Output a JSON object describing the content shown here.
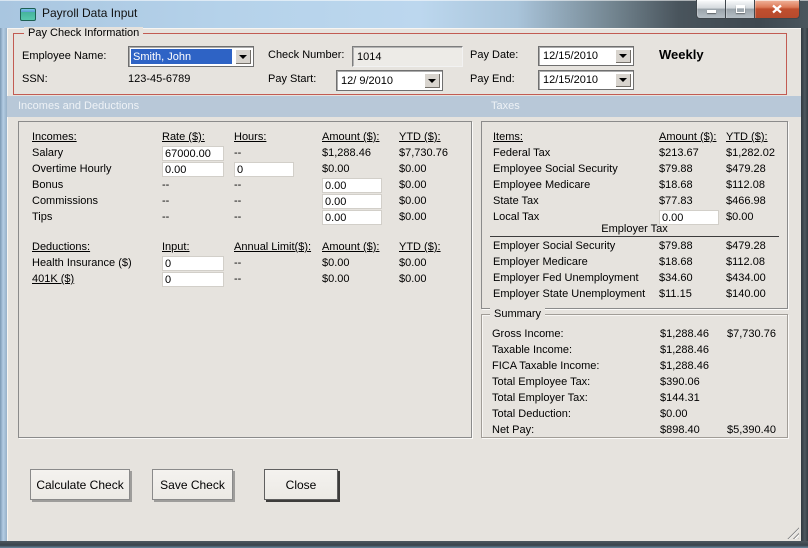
{
  "window": {
    "title": "Payroll Data Input"
  },
  "icons": {
    "app": "form-window-icon",
    "minimize": "minimize-icon",
    "maximize": "maximize-icon",
    "close": "close-icon",
    "dropdown": "chevron-down-icon",
    "resize": "resize-grip-icon"
  },
  "colors": {
    "section_header_bg": "#b8c8d8",
    "group_border_red": "#c25b52",
    "selection_blue": "#2e63c5",
    "close_button_red": "#c04f2e",
    "client_bg": "#e6e3de"
  },
  "paycheck": {
    "group_label": "Pay Check Information",
    "employee_name": {
      "label": "Employee Name:",
      "value": "Smith, John"
    },
    "ssn": {
      "label": "SSN:",
      "value": "123-45-6789"
    },
    "check_number": {
      "label": "Check Number:",
      "value": "1014"
    },
    "pay_start": {
      "label": "Pay Start:",
      "value": "12/ 9/2010"
    },
    "pay_date": {
      "label": "Pay Date:",
      "value": "12/15/2010"
    },
    "pay_end": {
      "label": "Pay End:",
      "value": "12/15/2010"
    },
    "frequency": "Weekly"
  },
  "section_headers": {
    "left": "Incomes and Deductions",
    "right": "Taxes"
  },
  "incomes": {
    "headers": {
      "item": "Incomes:",
      "rate": "Rate ($):",
      "hours": "Hours:",
      "amount": "Amount ($):",
      "ytd": "YTD ($):"
    },
    "rows": [
      {
        "label": "Salary",
        "rate": "67000.00",
        "hours": "--",
        "amount": "$1,288.46",
        "ytd": "$7,730.76"
      },
      {
        "label": "Overtime Hourly",
        "rate": "0.00",
        "hours": "0",
        "amount": "$0.00",
        "ytd": "$0.00"
      },
      {
        "label": "Bonus",
        "rate": "--",
        "hours": "--",
        "amount": "0.00",
        "ytd": "$0.00"
      },
      {
        "label": "Commissions",
        "rate": "--",
        "hours": "--",
        "amount": "0.00",
        "ytd": "$0.00"
      },
      {
        "label": "Tips",
        "rate": "--",
        "hours": "--",
        "amount": "0.00",
        "ytd": "$0.00"
      }
    ]
  },
  "deductions": {
    "headers": {
      "item": "Deductions:",
      "input": "Input:",
      "limit": "Annual Limit($):",
      "amount": "Amount ($):",
      "ytd": "YTD ($):"
    },
    "rows": [
      {
        "label": "Health Insurance ($)",
        "input": "0",
        "limit": "--",
        "amount": "$0.00",
        "ytd": "$0.00"
      },
      {
        "label": "401K ($)",
        "input": "0",
        "limit": "--",
        "amount": "$0.00",
        "ytd": "$0.00"
      }
    ]
  },
  "taxes": {
    "headers": {
      "item": "Items:",
      "amount": "Amount ($):",
      "ytd": "YTD ($):"
    },
    "rows": [
      {
        "label": "Federal Tax",
        "amount": "$213.67",
        "ytd": "$1,282.02"
      },
      {
        "label": "Employee Social Security",
        "amount": "$79.88",
        "ytd": "$479.28"
      },
      {
        "label": "Employee Medicare",
        "amount": "$18.68",
        "ytd": "$112.08"
      },
      {
        "label": "State Tax",
        "amount": "$77.83",
        "ytd": "$466.98"
      },
      {
        "label": "Local Tax",
        "amount": "0.00",
        "ytd": "$0.00"
      }
    ],
    "employer_header": "Employer Tax",
    "employer_rows": [
      {
        "label": "Employer Social Security",
        "amount": "$79.88",
        "ytd": "$479.28"
      },
      {
        "label": "Employer Medicare",
        "amount": "$18.68",
        "ytd": "$112.08"
      },
      {
        "label": "Employer Fed Unemployment",
        "amount": "$34.60",
        "ytd": "$434.00"
      },
      {
        "label": "Employer State Unemployment",
        "amount": "$11.15",
        "ytd": "$140.00"
      }
    ]
  },
  "summary": {
    "group_label": "Summary",
    "rows": [
      {
        "label": "Gross Income:",
        "amount": "$1,288.46",
        "ytd": "$7,730.76"
      },
      {
        "label": "Taxable Income:",
        "amount": "$1,288.46",
        "ytd": ""
      },
      {
        "label": "FICA Taxable Income:",
        "amount": "$1,288.46",
        "ytd": ""
      },
      {
        "label": "Total Employee Tax:",
        "amount": "$390.06",
        "ytd": ""
      },
      {
        "label": "Total Employer Tax:",
        "amount": "$144.31",
        "ytd": ""
      },
      {
        "label": "Total Deduction:",
        "amount": "$0.00",
        "ytd": ""
      },
      {
        "label": "Net Pay:",
        "amount": "$898.40",
        "ytd": "$5,390.40"
      }
    ]
  },
  "buttons": {
    "calculate": "Calculate Check",
    "save": "Save Check",
    "close": "Close"
  }
}
